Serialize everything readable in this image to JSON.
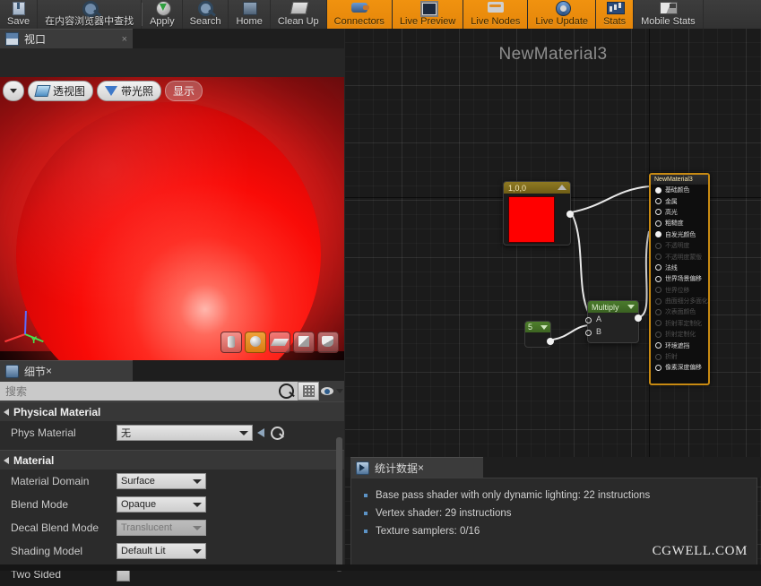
{
  "toolbar": {
    "items": [
      {
        "label": "Save",
        "icon": "save-icon",
        "style": "dark"
      },
      {
        "label": "在内容浏览器中查找",
        "icon": "find-in-content-browser-icon",
        "style": "dark"
      },
      {
        "label": "Apply",
        "icon": "apply-icon",
        "style": "dark"
      },
      {
        "label": "Search",
        "icon": "search-icon",
        "style": "dark"
      },
      {
        "label": "Home",
        "icon": "home-icon",
        "style": "dark"
      },
      {
        "label": "Clean Up",
        "icon": "clean-up-icon",
        "style": "dark"
      },
      {
        "label": "Connectors",
        "icon": "connectors-icon",
        "style": "orange"
      },
      {
        "label": "Live Preview",
        "icon": "live-preview-icon",
        "style": "orange"
      },
      {
        "label": "Live Nodes",
        "icon": "live-nodes-icon",
        "style": "orange"
      },
      {
        "label": "Live Update",
        "icon": "live-update-icon",
        "style": "orange"
      },
      {
        "label": "Stats",
        "icon": "stats-icon",
        "style": "orange"
      },
      {
        "label": "Mobile Stats",
        "icon": "mobile-stats-icon",
        "style": "dark"
      }
    ]
  },
  "viewport": {
    "tab_label": "视口",
    "tab_close": "×",
    "controls": {
      "view_menu_icon": "chevron-down-icon",
      "perspective": "透视图",
      "lit": "带光照",
      "show": "显示"
    },
    "gizmo": {
      "x": "X",
      "y": "Y",
      "z": "Z"
    },
    "shape_buttons": [
      {
        "name": "preview-shape-cylinder",
        "selected": false
      },
      {
        "name": "preview-shape-sphere",
        "selected": true
      },
      {
        "name": "preview-shape-plane",
        "selected": false
      },
      {
        "name": "preview-shape-cube",
        "selected": false
      },
      {
        "name": "preview-shape-custom",
        "selected": false
      }
    ]
  },
  "details": {
    "tab_label": "细节",
    "tab_close": "×",
    "search_placeholder": "搜索",
    "search_value": "",
    "sections": [
      {
        "title": "Physical Material",
        "rows": [
          {
            "label": "Phys Material",
            "type": "combo-wide",
            "value": "无",
            "disabled": false,
            "extras": [
              "back-arrow-icon",
              "browse-icon"
            ]
          }
        ]
      },
      {
        "title": "Material",
        "rows": [
          {
            "label": "Material Domain",
            "type": "combo",
            "value": "Surface",
            "disabled": false
          },
          {
            "label": "Blend Mode",
            "type": "combo",
            "value": "Opaque",
            "disabled": false
          },
          {
            "label": "Decal Blend Mode",
            "type": "combo",
            "value": "Translucent",
            "disabled": true
          },
          {
            "label": "Shading Model",
            "type": "combo",
            "value": "Default Lit",
            "disabled": false
          },
          {
            "label": "Two Sided",
            "type": "checkbox",
            "value": "",
            "disabled": false
          }
        ]
      }
    ]
  },
  "graph": {
    "title": "NewMaterial3",
    "nodes": {
      "constant_vector": {
        "title": "1,0,0",
        "color": "#ff0000"
      },
      "scalar": {
        "title": "5"
      },
      "multiply": {
        "title": "Multiply",
        "inputs": [
          "A",
          "B"
        ]
      },
      "material_output": {
        "title": "NewMaterial3",
        "pins": [
          {
            "label": "基础颜色",
            "connected": true,
            "enabled": true
          },
          {
            "label": "金属",
            "connected": false,
            "enabled": true
          },
          {
            "label": "高光",
            "connected": false,
            "enabled": true
          },
          {
            "label": "粗糙度",
            "connected": false,
            "enabled": true
          },
          {
            "label": "自发光颜色",
            "connected": true,
            "enabled": true
          },
          {
            "label": "不透明度",
            "connected": false,
            "enabled": false
          },
          {
            "label": "不透明度蒙版",
            "connected": false,
            "enabled": false
          },
          {
            "label": "法线",
            "connected": false,
            "enabled": true
          },
          {
            "label": "世界场景偏移",
            "connected": false,
            "enabled": true
          },
          {
            "label": "世界位移",
            "connected": false,
            "enabled": false
          },
          {
            "label": "曲面细分多面化",
            "connected": false,
            "enabled": false
          },
          {
            "label": "次表面颜色",
            "connected": false,
            "enabled": false
          },
          {
            "label": "折射率定制化",
            "connected": false,
            "enabled": false
          },
          {
            "label": "折射定制化",
            "connected": false,
            "enabled": false
          },
          {
            "label": "环境遮挡",
            "connected": false,
            "enabled": true
          },
          {
            "label": "折射",
            "connected": false,
            "enabled": false
          },
          {
            "label": "像素深度偏移",
            "connected": false,
            "enabled": true
          }
        ]
      }
    }
  },
  "stats": {
    "tab_label": "统计数据",
    "tab_close": "×",
    "items": [
      "Base pass shader with only dynamic lighting: 22 instructions",
      "Vertex shader: 29 instructions",
      "Texture samplers: 0/16"
    ],
    "watermark": "CGWELL.COM"
  }
}
